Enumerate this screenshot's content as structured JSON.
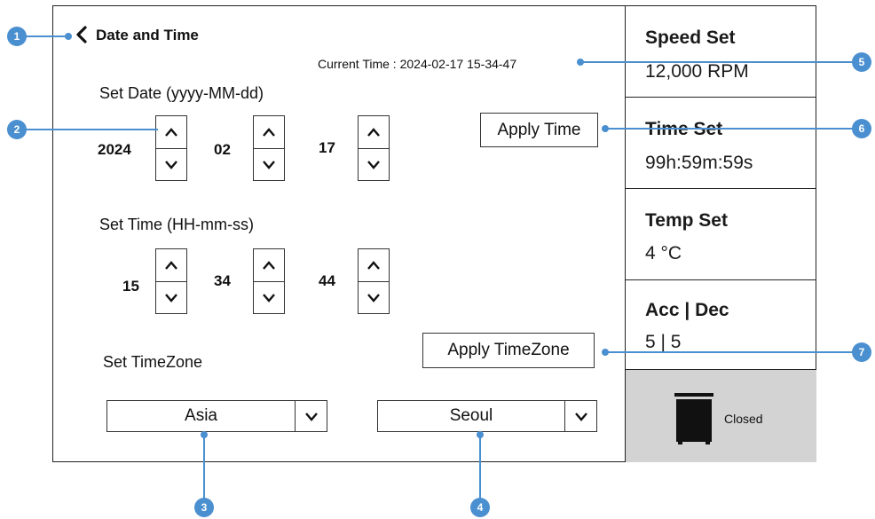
{
  "header": {
    "title": "Date and Time",
    "back_icon": "chevron-left-icon"
  },
  "current_time": "Current Time : 2024-02-17 15-34-47",
  "date": {
    "label": "Set Date (yyyy-MM-dd)",
    "year": "2024",
    "month": "02",
    "day": "17"
  },
  "time": {
    "label": "Set Time (HH-mm-ss)",
    "hour": "15",
    "minute": "34",
    "second": "44"
  },
  "timezone": {
    "label": "Set TimeZone",
    "region": "Asia",
    "city": "Seoul"
  },
  "buttons": {
    "apply_time": "Apply Time",
    "apply_timezone": "Apply TimeZone"
  },
  "status_panel": {
    "speed": {
      "label": "Speed Set",
      "value": "12,000 RPM"
    },
    "time": {
      "label": "Time Set",
      "value": "99h:59m:59s"
    },
    "temp": {
      "label": "Temp Set",
      "value": "4 °C"
    },
    "accdec": {
      "label": "Acc | Dec",
      "value": "5 | 5"
    },
    "door": {
      "status": "Closed",
      "icon": "door-closed-icon"
    }
  },
  "callouts": [
    "1",
    "2",
    "3",
    "4",
    "5",
    "6",
    "7"
  ],
  "colors": {
    "callout": "#4a8fd0",
    "door_bg": "#d3d3d3"
  }
}
